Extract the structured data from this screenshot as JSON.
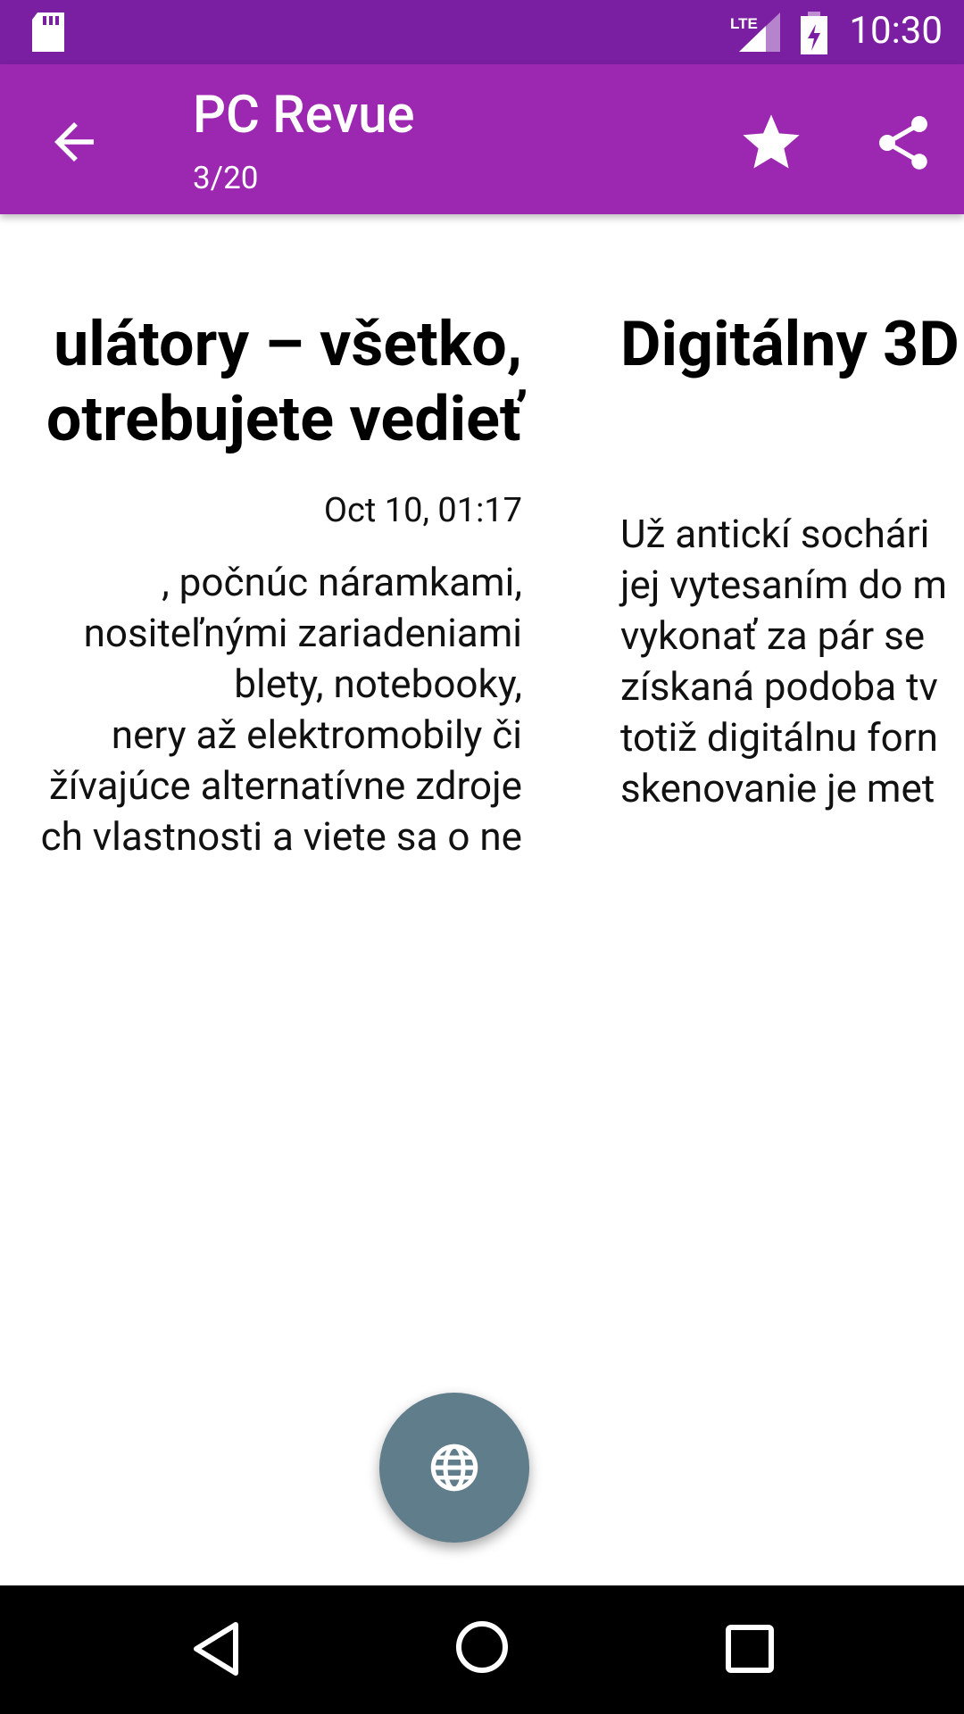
{
  "status_bar": {
    "time": "10:30",
    "network": "LTE",
    "icons": [
      "sd-card-icon",
      "signal-icon",
      "battery-charging-icon"
    ]
  },
  "app_bar": {
    "title": "PC Revue",
    "subtitle": "3/20",
    "icons": [
      "back-arrow-icon",
      "star-icon",
      "share-icon"
    ]
  },
  "articles": [
    {
      "title_lines": [
        "ulátory – všetko,",
        "otrebujete vedieť"
      ],
      "date": "Oct 10, 01:17",
      "text_lines": [
        ", počnúc náramkami,",
        " nositeľnými zariadeniami",
        "blety, notebooky,",
        "nery až elektromobily či",
        "žívajúce alternatívne zdroje",
        "ch vlastnosti a viete sa o ne"
      ]
    },
    {
      "title_lines": [
        "Digitálny 3D"
      ],
      "text_lines": [
        "Už antickí sochári",
        "jej vytesaním do m",
        "vykonať  za pár se",
        "získaná podoba tv",
        "totiž digitálnu forn",
        "skenovanie je met"
      ]
    }
  ],
  "fab": {
    "icon": "globe-icon"
  },
  "nav_bar": {
    "icons": [
      "nav-back-icon",
      "nav-home-icon",
      "nav-recents-icon"
    ]
  },
  "colors": {
    "status_bar": "#7B1FA2",
    "app_bar": "#9C27B0",
    "fab": "#607D8B",
    "nav_bar": "#000000"
  }
}
